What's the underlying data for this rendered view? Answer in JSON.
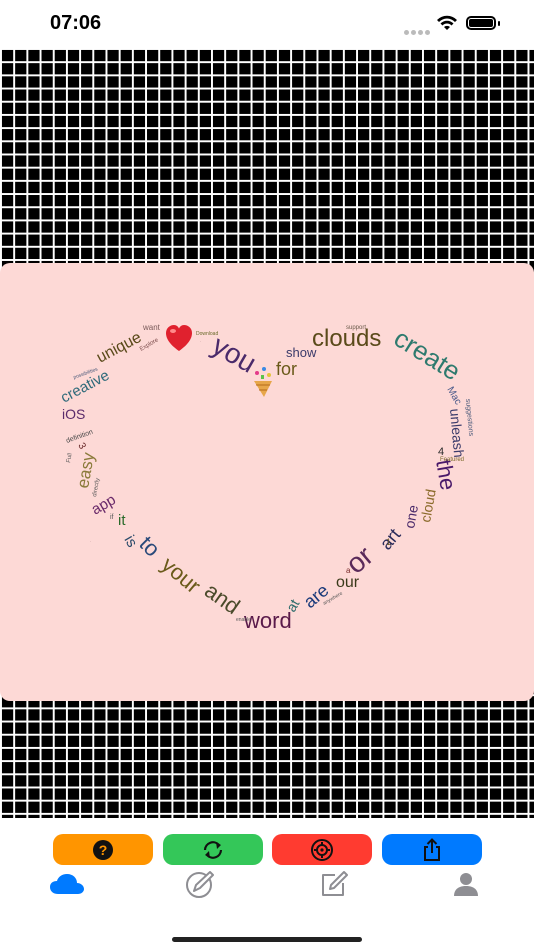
{
  "status_bar": {
    "time": "07:06"
  },
  "word_cloud": {
    "shape": "heart",
    "background_color": "#fdd9d6",
    "words": [
      {
        "text": "clouds",
        "color": "#5a4a1a"
      },
      {
        "text": "create",
        "color": "#2e7a6e"
      },
      {
        "text": "you",
        "color": "#4a2a6a"
      },
      {
        "text": "for",
        "color": "#6a5a1a"
      },
      {
        "text": "show",
        "color": "#3a3a6a"
      },
      {
        "text": "unique",
        "color": "#5a4a1a"
      },
      {
        "text": "creative",
        "color": "#2e6a7a"
      },
      {
        "text": "iOS",
        "color": "#5a2a6a"
      },
      {
        "text": "easy",
        "color": "#8a7a3a"
      },
      {
        "text": "app",
        "color": "#6a2a6a"
      },
      {
        "text": "it",
        "color": "#2a6a2a"
      },
      {
        "text": "is",
        "color": "#2a4a6a"
      },
      {
        "text": "to",
        "color": "#2a4a7a"
      },
      {
        "text": "your",
        "color": "#6a5a1a"
      },
      {
        "text": "and",
        "color": "#4a4a2a"
      },
      {
        "text": "word",
        "color": "#5a1a4a"
      },
      {
        "text": "at",
        "color": "#2a6a6a"
      },
      {
        "text": "are",
        "color": "#1a3a7a"
      },
      {
        "text": "our",
        "color": "#3a3a1a"
      },
      {
        "text": "or",
        "color": "#5a2a5a"
      },
      {
        "text": "art",
        "color": "#2a2a5a"
      },
      {
        "text": "one",
        "color": "#4a2a6a"
      },
      {
        "text": "cloud",
        "color": "#8a6a2a"
      },
      {
        "text": "the",
        "color": "#4a1a6a"
      },
      {
        "text": "unleash",
        "color": "#3a3a6a"
      },
      {
        "text": "Mac",
        "color": "#4a5a8a"
      },
      {
        "text": "want",
        "color": "#7a5a5a"
      },
      {
        "text": "Explore",
        "color": "#7a4a4a"
      },
      {
        "text": "Download",
        "color": "#6a6a2a"
      },
      {
        "text": "support",
        "color": "#6a5a4a"
      },
      {
        "text": "definition",
        "color": "#4a4a4a"
      },
      {
        "text": "Featured",
        "color": "#7a6a2a"
      },
      {
        "text": "suggestions",
        "color": "#4a5a7a"
      },
      {
        "text": "directly",
        "color": "#5a5a5a"
      },
      {
        "text": "anywhere",
        "color": "#5a5a5a"
      },
      {
        "text": "a",
        "color": "#7a2a2a"
      },
      {
        "text": "4",
        "color": "#2a2a2a"
      },
      {
        "text": "3",
        "color": "#6a2a2a"
      },
      {
        "text": "1",
        "color": "#6a5a2a"
      },
      {
        "text": "if",
        "color": "#5a5a5a"
      },
      {
        "text": "Full",
        "color": "#5a5a5a"
      },
      {
        "text": "possibilities",
        "color": "#4a5a7a"
      },
      {
        "text": "enable",
        "color": "#5a5a5a"
      }
    ]
  },
  "actions": [
    {
      "name": "help-button",
      "icon": "question-circle-icon",
      "color": "#ff9500"
    },
    {
      "name": "refresh-button",
      "icon": "refresh-icon",
      "color": "#34c759"
    },
    {
      "name": "settings-button",
      "icon": "gear-badge-icon",
      "color": "#ff3b30"
    },
    {
      "name": "share-button",
      "icon": "share-icon",
      "color": "#007aff"
    }
  ],
  "tabs": [
    {
      "name": "tab-cloud",
      "icon": "cloud-icon",
      "active": true
    },
    {
      "name": "tab-style",
      "icon": "pen-circle-icon",
      "active": false
    },
    {
      "name": "tab-edit",
      "icon": "compose-icon",
      "active": false
    },
    {
      "name": "tab-profile",
      "icon": "person-icon",
      "active": false
    }
  ],
  "colors": {
    "accent": "#007aff",
    "grid_background": "#000000",
    "grid_lines": "#ffffff"
  }
}
